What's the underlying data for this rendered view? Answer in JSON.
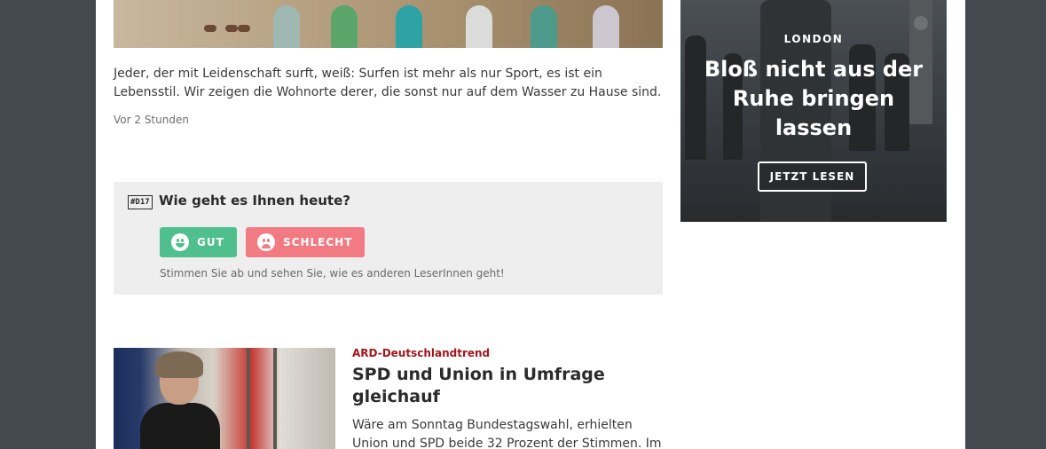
{
  "teaser": {
    "text": "Jeder, der mit Leidenschaft surft, weiß: Surfen ist mehr als nur Sport, es ist ein Lebensstil. Wir zeigen die Wohnorte derer, die sonst nur auf dem Wasser zu Hause sind.",
    "time": "Vor 2 Stunden"
  },
  "poll": {
    "tag": "#D17",
    "question": "Wie geht es Ihnen heute?",
    "good_label": "GUT",
    "bad_label": "SCHLECHT",
    "hint": "Stimmen Sie ab und sehen Sie, wie es anderen LeserInnen geht!",
    "colors": {
      "good": "#4fc08d",
      "bad": "#f27a83"
    }
  },
  "article": {
    "kicker": "ARD-Deutschlandtrend",
    "headline": "SPD und Union in Umfrage gleichauf",
    "excerpt": "Wäre am Sonntag Bundestagswahl, erhielten Union und SPD beide 32 Prozent der Stimmen. Im",
    "kicker_color": "#a2161c"
  },
  "promo": {
    "city": "LONDON",
    "title": "Bloß nicht aus der Ruhe bringen lassen",
    "button": "JETZT LESEN"
  }
}
